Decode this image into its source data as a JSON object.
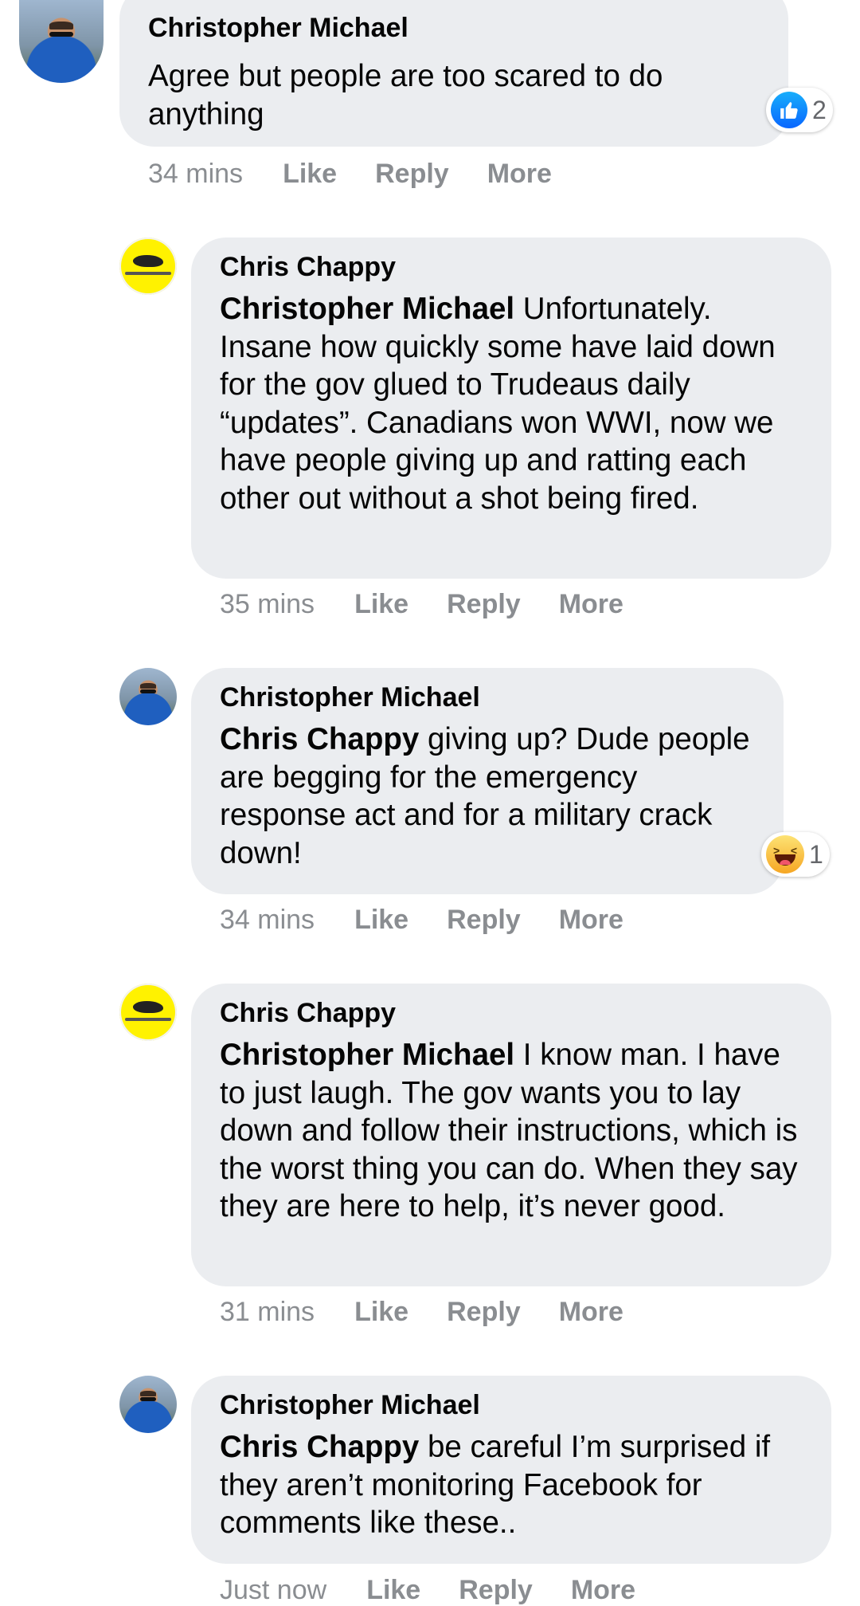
{
  "comments": [
    {
      "author": "Christopher Michael",
      "mention": "",
      "text": "Agree but people are too scared to do anything",
      "time": "34 mins",
      "reaction": {
        "icon": "like-icon",
        "count": "2",
        "color": "#0866ff"
      }
    },
    {
      "author": "Chris Chappy",
      "mention": "Christopher Michael",
      "text": "Unfortunately. Insane how quickly some have laid down for the gov glued to Trudeaus daily “updates”. Canadians won WWI, now we have people giving up and ratting each other out without a shot being fired.",
      "time": "35 mins"
    },
    {
      "author": "Christopher Michael",
      "mention": "Chris Chappy",
      "text": "giving up? Dude people are begging for the emergency response act and for a military crack down!",
      "time": "34 mins",
      "reaction": {
        "icon": "haha-icon",
        "count": "1",
        "color": "#f7b125"
      }
    },
    {
      "author": "Chris Chappy",
      "mention": "Christopher Michael",
      "text": "I know man. I have to just laugh. The gov wants you to lay down and follow their instructions, which is the worst thing you can do. When they say they are here to help, it’s never good.",
      "time": "31 mins"
    },
    {
      "author": "Christopher Michael",
      "mention": "Chris Chappy",
      "text": "be careful I’m surprised if they aren’t monitoring Facebook for comments like these..",
      "time": "Just now"
    }
  ],
  "actions": {
    "like": "Like",
    "reply": "Reply",
    "more": "More"
  },
  "colors": {
    "bubble": "#ebedf0",
    "meta_text": "#8a8d91",
    "like_blue": "#0866ff",
    "avatar_yellow": "#fff200"
  }
}
